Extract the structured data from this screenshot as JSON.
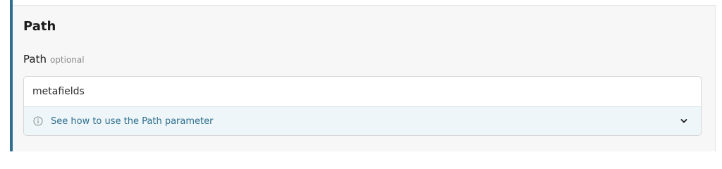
{
  "section": {
    "title": "Path"
  },
  "field": {
    "label": "Path",
    "optional_label": "optional",
    "value": "metafields"
  },
  "help": {
    "text": "See how to use the Path parameter",
    "icon": "info-icon",
    "expand_icon": "chevron-down-icon"
  },
  "colors": {
    "accent": "#2f6e8e",
    "help_background": "#eef6f9",
    "help_text": "#2f6e8e"
  }
}
